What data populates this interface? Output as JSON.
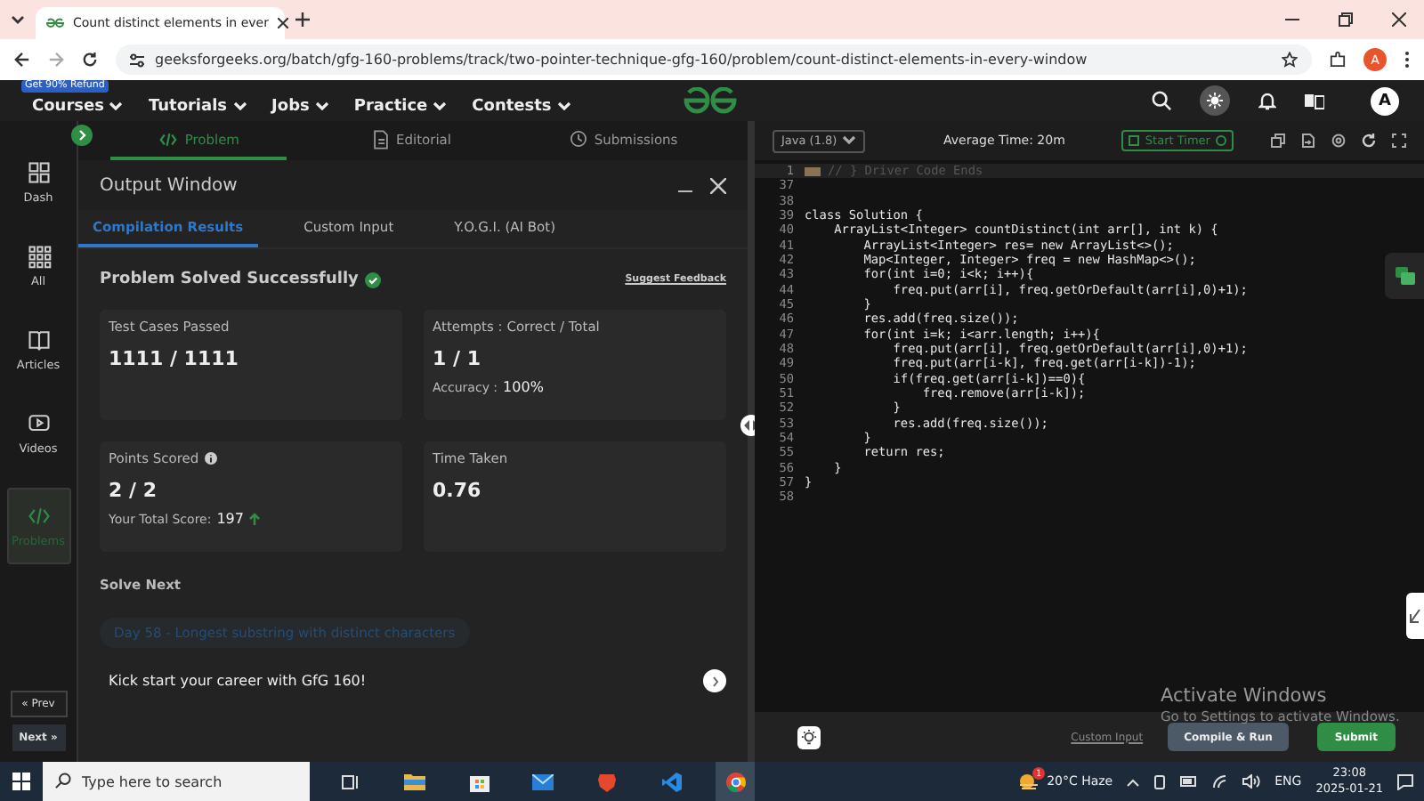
{
  "browser": {
    "tab_title": "Count distinct elements in ever",
    "url": "geeksforgeeks.org/batch/gfg-160-problems/track/two-pointer-technique-gfg-160/problem/count-distinct-elements-in-every-window",
    "profile": "A"
  },
  "nav": {
    "badge": "Get 90% Refund",
    "menus": [
      "Courses",
      "Tutorials",
      "Jobs",
      "Practice",
      "Contests"
    ],
    "avatar": "A"
  },
  "sidebar": {
    "items": [
      {
        "label": "Dash",
        "kind": "dash",
        "selected": false
      },
      {
        "label": "All",
        "kind": "all",
        "selected": false
      },
      {
        "label": "Articles",
        "kind": "articles",
        "selected": false
      },
      {
        "label": "Videos",
        "kind": "videos",
        "selected": false
      },
      {
        "label": "Problems",
        "kind": "problems",
        "selected": true
      }
    ],
    "prev": "« Prev",
    "next": "Next »"
  },
  "problem_tabs": [
    {
      "label": "Problem",
      "kind": "code",
      "selected": true
    },
    {
      "label": "Editorial",
      "kind": "doc",
      "selected": false
    },
    {
      "label": "Submissions",
      "kind": "clock",
      "selected": false
    }
  ],
  "output_window": {
    "title": "Output Window",
    "tabs": [
      {
        "label": "Compilation Results",
        "selected": true
      },
      {
        "label": "Custom Input",
        "selected": false
      },
      {
        "label": "Y.O.G.I. (AI Bot)",
        "selected": false
      }
    ],
    "status": "Problem Solved Successfully",
    "feedback_link": "Suggest Feedback",
    "cards": [
      {
        "label": "Test Cases Passed",
        "value": "1111 / 1111"
      },
      {
        "label": "Attempts : Correct / Total",
        "value": "1 / 1",
        "note_label": "Accuracy :",
        "note_value": "100%"
      },
      {
        "label": "Points Scored",
        "info": true,
        "value": "2 / 2",
        "note_label": "Your Total Score:",
        "note_value": "197",
        "rising": true
      },
      {
        "label": "Time Taken",
        "value": "0.76"
      }
    ],
    "solve_next_title": "Solve Next",
    "next_problem": "Day 58 - Longest substring with distinct characters",
    "promo": "Kick start your career with GfG 160!"
  },
  "editor": {
    "language": "Java (1.8)",
    "average_time": "Average Time: 20m",
    "timer_button": "Start Timer",
    "lines": [
      {
        "n": "1",
        "text": "// } Driver Code Ends",
        "folded": true
      },
      {
        "n": "37",
        "folded": false
      },
      {
        "n": "38",
        "folded": false
      },
      {
        "n": "39",
        "text": "class Solution {",
        "folded": false
      },
      {
        "n": "40",
        "text": "    ArrayList<Integer> countDistinct(int arr[], int k) {",
        "folded": false
      },
      {
        "n": "41",
        "text": "        ArrayList<Integer> res= new ArrayList<>();",
        "folded": false
      },
      {
        "n": "42",
        "text": "        Map<Integer, Integer> freq = new HashMap<>();",
        "folded": false
      },
      {
        "n": "43",
        "text": "        for(int i=0; i<k; i++){",
        "folded": false
      },
      {
        "n": "44",
        "text": "            freq.put(arr[i], freq.getOrDefault(arr[i],0)+1);",
        "folded": false
      },
      {
        "n": "45",
        "text": "        }",
        "folded": false
      },
      {
        "n": "46",
        "text": "        res.add(freq.size());",
        "folded": false
      },
      {
        "n": "47",
        "text": "        for(int i=k; i<arr.length; i++){",
        "folded": false
      },
      {
        "n": "48",
        "text": "            freq.put(arr[i], freq.getOrDefault(arr[i],0)+1);",
        "folded": false
      },
      {
        "n": "49",
        "text": "            freq.put(arr[i-k], freq.get(arr[i-k])-1);",
        "folded": false
      },
      {
        "n": "50",
        "text": "            if(freq.get(arr[i-k])==0){",
        "folded": false
      },
      {
        "n": "51",
        "text": "                freq.remove(arr[i-k]);",
        "folded": false
      },
      {
        "n": "52",
        "text": "            }",
        "folded": false
      },
      {
        "n": "53",
        "text": "            res.add(freq.size());",
        "folded": false
      },
      {
        "n": "54",
        "text": "        }",
        "folded": false
      },
      {
        "n": "55",
        "text": "        return res;",
        "folded": false
      },
      {
        "n": "56",
        "text": "    }",
        "folded": false
      },
      {
        "n": "57",
        "text": "}",
        "folded": false
      },
      {
        "n": "58",
        "folded": false
      }
    ],
    "custom_input": "Custom Input",
    "compile_button": "Compile & Run",
    "submit_button": "Submit"
  },
  "activation": {
    "title": "Activate Windows",
    "subtitle": "Go to Settings to activate Windows."
  },
  "taskbar": {
    "search_placeholder": "Type here to search",
    "weather": "20°C Haze",
    "weather_alert": "1",
    "language": "ENG",
    "time": "23:08",
    "date": "2025-01-21"
  }
}
